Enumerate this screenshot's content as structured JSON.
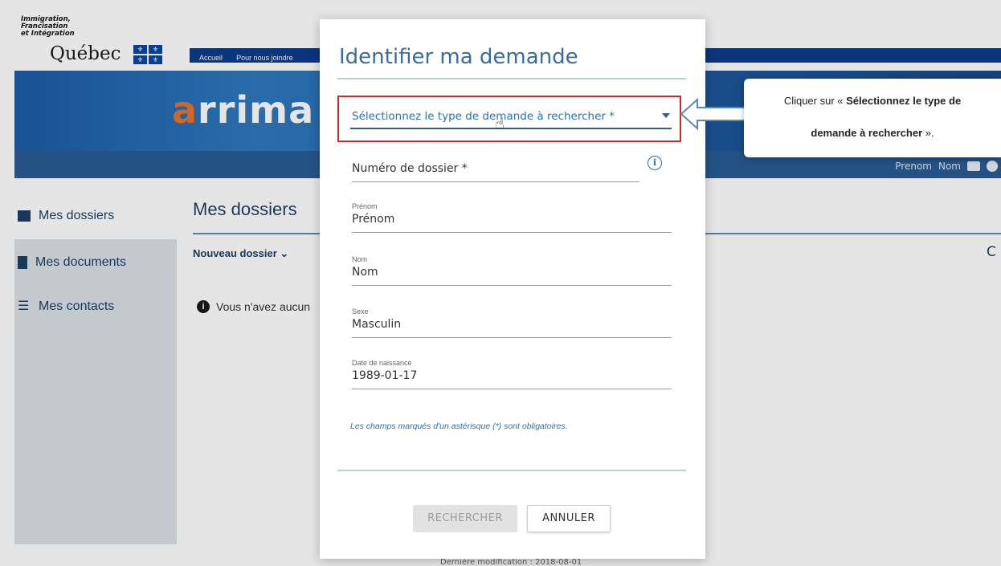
{
  "brand": {
    "ministry": "Immigration,\nFrancisation\net Intégration",
    "quebec": "Québec",
    "app_wordmark": "arrima"
  },
  "topnav": {
    "items": [
      "Accueil",
      "Pour nous joindre"
    ]
  },
  "user": {
    "first_name": "Prenom",
    "last_name": "Nom"
  },
  "sidebar": {
    "items": [
      {
        "label": "Mes dossiers",
        "icon": "folder-icon"
      },
      {
        "label": "Mes documents",
        "icon": "document-icon"
      },
      {
        "label": "Mes contacts",
        "icon": "list-icon"
      }
    ]
  },
  "main": {
    "title": "Mes dossiers",
    "new_folder": "Nouveau dossier",
    "empty_message": "Vous n'avez aucun",
    "footer": "Dernière modification : 2018-08-01"
  },
  "modal": {
    "title": "Identifier ma demande",
    "select_placeholder": "Sélectionnez le type de demande à rechercher *",
    "fields": {
      "dossier": {
        "placeholder": "Numéro de dossier *"
      },
      "prenom": {
        "label": "Prénom",
        "value": "Prénom"
      },
      "nom": {
        "label": "Nom",
        "value": "Nom"
      },
      "sexe": {
        "label": "Sexe",
        "value": "Masculin"
      },
      "naissance": {
        "label": "Date de naissance",
        "value": "1989-01-17"
      }
    },
    "required_note": "Les champs marqués d'un astérisque (*) sont obligatoires.",
    "buttons": {
      "search": "RECHERCHER",
      "cancel": "ANNULER"
    }
  },
  "annotation": {
    "line1_prefix": "Cliquer sur « ",
    "line1_bold": "Sélectionnez le type de",
    "line2_bold": "demande à rechercher",
    "line2_suffix": " »."
  },
  "colors": {
    "accent": "#2a72a8",
    "highlight_border": "#cc2b2b",
    "banner": "#1c5ca6",
    "nav": "#0c3b8a"
  }
}
